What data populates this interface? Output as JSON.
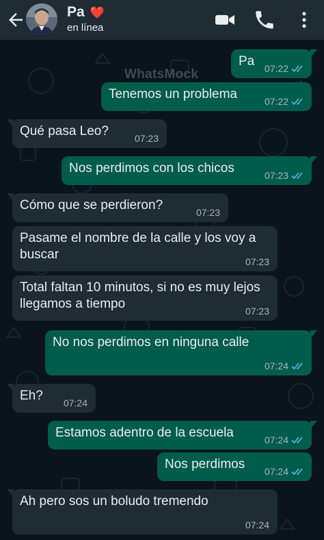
{
  "header": {
    "contact_name": "Pa",
    "contact_emoji": "❤️",
    "status": "en línea",
    "icons": [
      "back-arrow-icon",
      "video-call-icon",
      "phone-icon",
      "more-options-icon"
    ]
  },
  "watermark": "WhatsMock",
  "colors": {
    "header": "#1f2c34",
    "chat_background": "#0b141a",
    "outgoing_bubble": "#005c4b",
    "incoming_bubble": "#1f2c34",
    "read_ticks": "#53bdeb"
  },
  "messages": [
    {
      "dir": "out",
      "text": "Pa",
      "time": "07:22",
      "read": true
    },
    {
      "dir": "out",
      "text": "Tenemos un problema",
      "time": "07:22",
      "read": true
    },
    {
      "dir": "in",
      "text": "Qué pasa Leo?",
      "time": "07:23"
    },
    {
      "dir": "out",
      "text": "Nos perdimos con los chicos",
      "time": "07:23",
      "read": true
    },
    {
      "dir": "in",
      "text": "Cómo que se perdieron?",
      "time": "07:23"
    },
    {
      "dir": "in",
      "text": "Pasame el nombre de la calle y los voy a buscar",
      "time": "07:23"
    },
    {
      "dir": "in",
      "text": "Total faltan 10 minutos, si no es muy lejos llegamos a tiempo",
      "time": "07:23"
    },
    {
      "dir": "out",
      "text": "No nos perdimos en ninguna calle",
      "time": "07:24",
      "read": true
    },
    {
      "dir": "in",
      "text": "Eh?",
      "time": "07:24"
    },
    {
      "dir": "out",
      "text": "Estamos adentro de la escuela",
      "time": "07:24",
      "read": true
    },
    {
      "dir": "out",
      "text": "Nos perdimos",
      "time": "07:24",
      "read": true
    },
    {
      "dir": "in",
      "text": "Ah pero sos un boludo tremendo",
      "time": "07:24"
    }
  ]
}
